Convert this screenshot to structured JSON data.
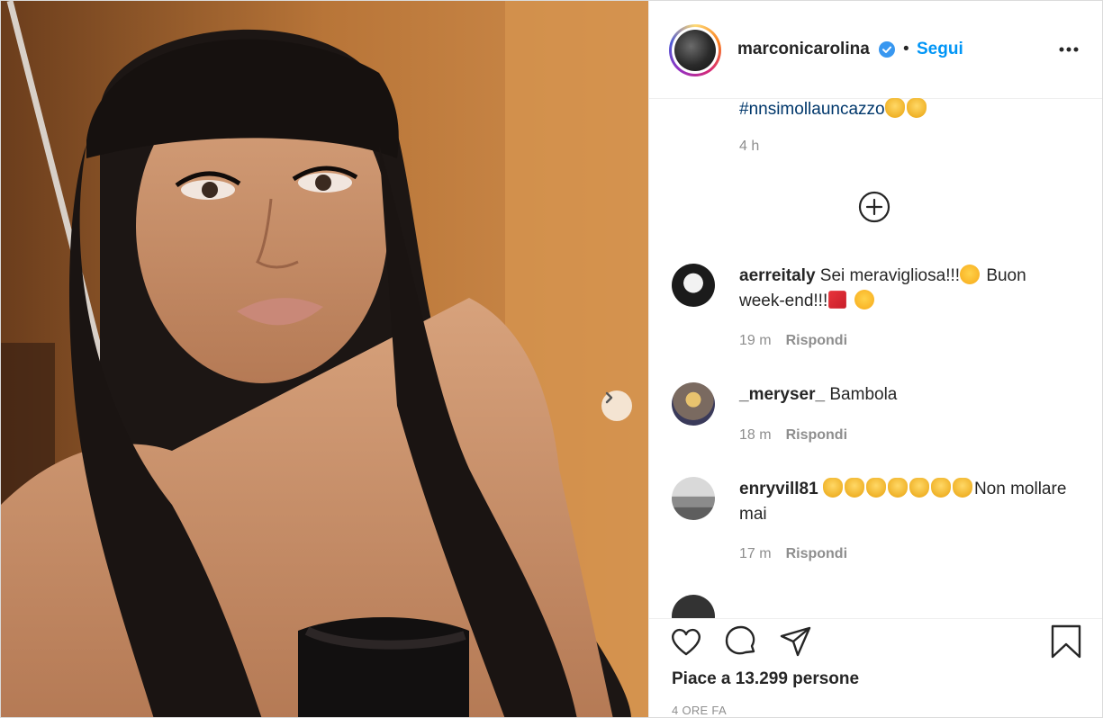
{
  "post": {
    "username": "marconicarolina",
    "dot": "•",
    "follow_label": "Segui",
    "hashtag": "#nnsimollauncazzo",
    "time": "4 h",
    "likes": "Piace a 13.299 persone",
    "date": "4 ORE FA"
  },
  "comments": [
    {
      "user": "aerreitaly",
      "text_a": "Sei meravigliosa!!!",
      "text_b": "Buon week-end!!!",
      "time": "19 m",
      "reply": "Rispondi"
    },
    {
      "user": "_meryser_",
      "text_a": "Bambola",
      "time": "18 m",
      "reply": "Rispondi"
    },
    {
      "user": "enryvill81",
      "text_a": "Non mollare mai",
      "time": "17 m",
      "reply": "Rispondi"
    }
  ],
  "colors": {
    "accent": "#0095f6",
    "hashtag": "#00376b",
    "muted": "#8e8e8e"
  },
  "icons": [
    "verified-badge-icon",
    "more-options-icon",
    "plus-circle-icon",
    "chevron-right-icon",
    "heart-icon",
    "comment-icon",
    "share-icon",
    "bookmark-icon"
  ]
}
